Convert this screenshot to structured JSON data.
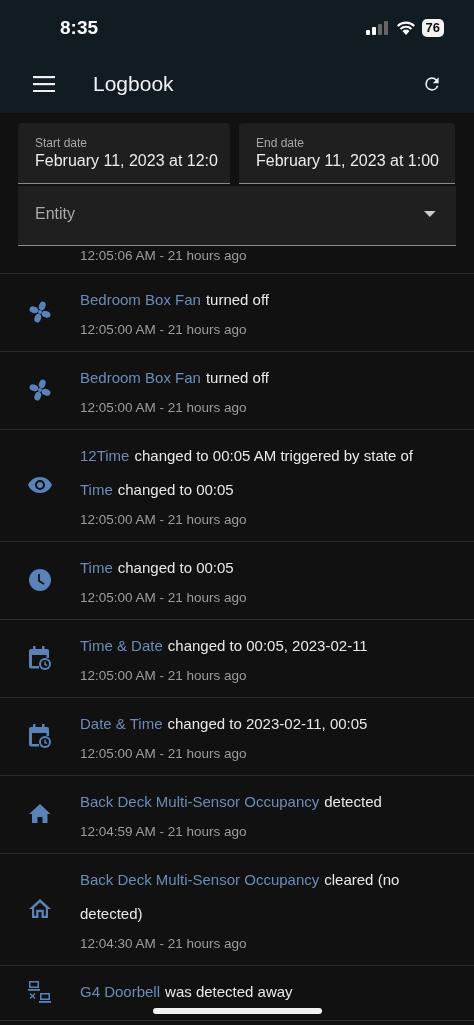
{
  "status_bar": {
    "time": "8:35",
    "battery": "76"
  },
  "app_bar": {
    "title": "Logbook"
  },
  "filters": {
    "start_date": {
      "label": "Start date",
      "value": "February 11, 2023 at 12:0"
    },
    "end_date": {
      "label": "End date",
      "value": "February 11, 2023 at 1:00"
    },
    "entity": {
      "placeholder": "Entity"
    }
  },
  "log_entries": [
    {
      "time": "12:05:06 AM - 21 hours ago"
    },
    {
      "kind": "fan",
      "entity": "Bedroom Box Fan",
      "message": "turned off",
      "time": "12:05:00 AM - 21 hours ago"
    },
    {
      "kind": "fan",
      "entity": "Bedroom Box Fan",
      "message": "turned off",
      "time": "12:05:00 AM - 21 hours ago"
    },
    {
      "kind": "eye",
      "entity": "12Time",
      "message": "changed to 00:05 AM triggered by state of",
      "context": {
        "entity": "Time",
        "message": "changed to 00:05"
      },
      "time": "12:05:00 AM - 21 hours ago"
    },
    {
      "kind": "clock",
      "entity": "Time",
      "message": "changed to 00:05",
      "time": "12:05:00 AM - 21 hours ago"
    },
    {
      "kind": "calendar-clock",
      "entity": "Time & Date",
      "message": "changed to 00:05, 2023-02-11",
      "time": "12:05:00 AM - 21 hours ago"
    },
    {
      "kind": "calendar-clock",
      "entity": "Date & Time",
      "message": "changed to 2023-02-11, 00:05",
      "time": "12:05:00 AM - 21 hours ago"
    },
    {
      "kind": "home",
      "entity": "Back Deck Multi-Sensor Occupancy",
      "message": "detected",
      "time": "12:04:59 AM - 21 hours ago"
    },
    {
      "kind": "home-outline",
      "entity": "Back Deck Multi-Sensor Occupancy",
      "message": "cleared (no detected)",
      "time": "12:04:30 AM - 21 hours ago"
    },
    {
      "kind": "network-off",
      "entity": "G4 Doorbell",
      "message": "was detected away"
    }
  ]
}
